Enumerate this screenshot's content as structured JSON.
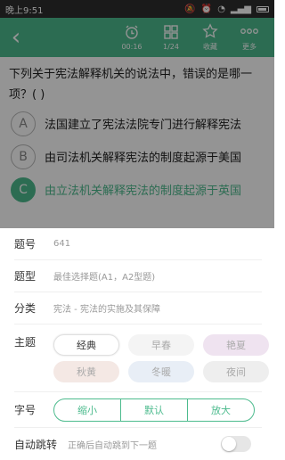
{
  "status": {
    "time": "晚上9:51"
  },
  "toolbar": {
    "timer": "00:16",
    "progress": "1/24",
    "favorite": "收藏",
    "more": "更多"
  },
  "question": {
    "stem": "下列关于宪法解释机关的说法中，错误的是哪一项？( )",
    "options": [
      {
        "letter": "A",
        "text": "法国建立了宪法法院专门进行解释宪法"
      },
      {
        "letter": "B",
        "text": "由司法机关解释宪法的制度起源于美国"
      },
      {
        "letter": "C",
        "text": "由立法机关解释宪法的制度起源于英国"
      }
    ]
  },
  "settings": {
    "number_label": "题号",
    "number_value": "641",
    "type_label": "题型",
    "type_value": "最佳选择题(A1，A2型题)",
    "category_label": "分类",
    "category_value": "宪法 - 宪法的实施及其保障",
    "theme_label": "主题",
    "themes": [
      "经典",
      "早春",
      "艳夏",
      "秋黄",
      "冬暖",
      "夜间"
    ],
    "font_label": "字号",
    "font_options": [
      "缩小",
      "默认",
      "放大"
    ],
    "autojump_label": "自动跳转",
    "autojump_hint": "正确后自动跳到下一题"
  },
  "colors": {
    "accent": "#4dbb8e",
    "theme_spring": "#f4f4f4",
    "theme_summer": "#efe3f0",
    "theme_autumn": "#f4e8e4",
    "theme_winter": "#e8eef6",
    "theme_night": "#eeeeee"
  }
}
